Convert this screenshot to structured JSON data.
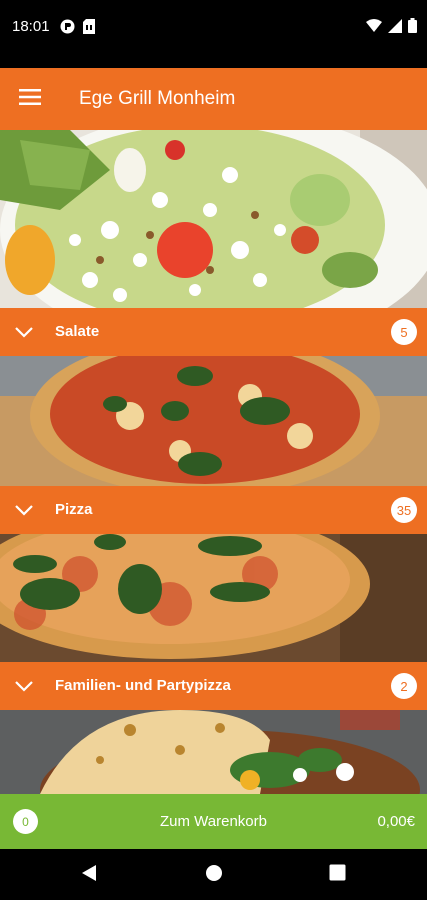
{
  "status_bar": {
    "time": "18:01",
    "icons": [
      "vpn-icon",
      "sim-icon",
      "wifi-icon",
      "signal-icon",
      "battery-icon"
    ]
  },
  "app_bar": {
    "title": "Ege Grill Monheim",
    "menu_icon": "hamburger-menu-icon"
  },
  "categories": [
    {
      "label": "Salate",
      "count": "5"
    },
    {
      "label": "Pizza",
      "count": "35"
    },
    {
      "label": "Familien- und Partypizza",
      "count": "2"
    }
  ],
  "cart": {
    "count": "0",
    "label": "Zum Warenkorb",
    "total": "0,00€"
  },
  "nav_bar": {
    "buttons": [
      "back-icon",
      "home-icon",
      "recents-icon"
    ]
  },
  "colors": {
    "accent": "#ee6f22",
    "cart": "#78b835"
  }
}
